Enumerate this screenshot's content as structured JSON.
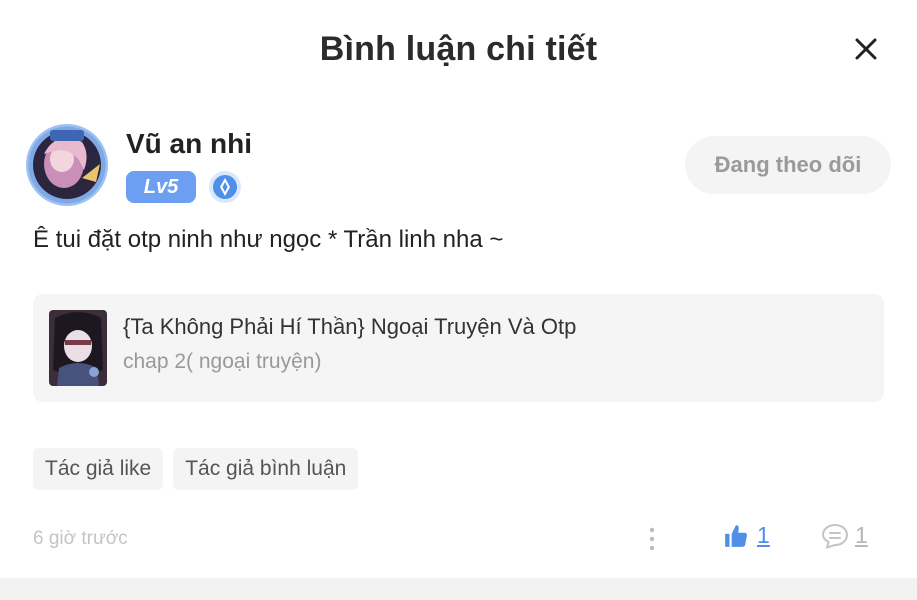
{
  "header": {
    "title": "Bình luận chi tiết"
  },
  "author": {
    "name": "Vũ an nhi",
    "level": "Lv5",
    "follow_label": "Đang theo dõi"
  },
  "comment": {
    "text": "Ê tui đặt otp ninh như ngọc * Trần linh nha ~"
  },
  "story": {
    "title": "{Ta Không Phải Hí Thần} Ngoại Truyện Và Otp",
    "chapter": "chap 2( ngoại truyện)"
  },
  "tags": [
    "Tác giả like",
    "Tác giả bình luận"
  ],
  "footer": {
    "time": "6 giờ trước",
    "like_count": "1",
    "reply_count": "1"
  },
  "colors": {
    "accent": "#4f8fe8",
    "level_badge": "#6c9ef2",
    "muted": "#9a9a9a"
  },
  "icons": {
    "close": "close-icon",
    "more": "more-vertical-icon",
    "like": "thumbs-up-icon",
    "reply": "comment-icon",
    "medal": "medal-icon"
  }
}
